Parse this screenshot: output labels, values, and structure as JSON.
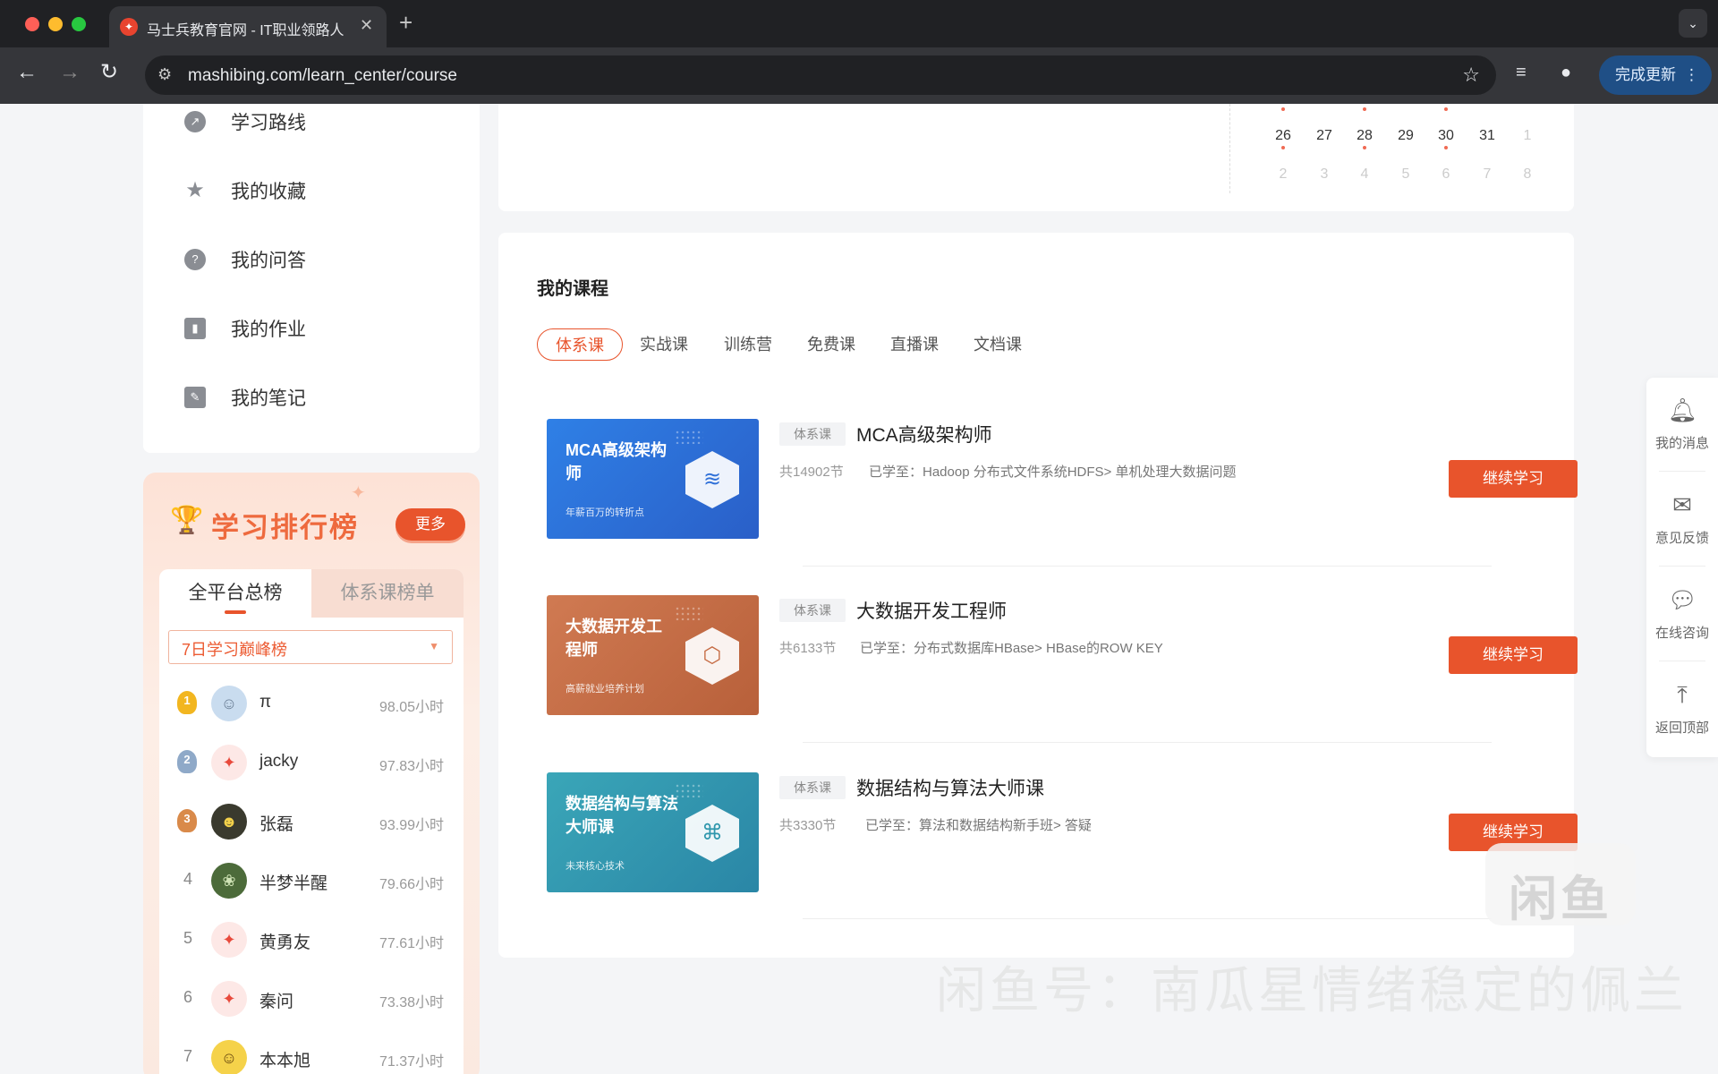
{
  "browser": {
    "tab_title": "马士兵教育官网 - IT职业领路人",
    "url": "mashibing.com/learn_center/course",
    "update_label": "完成更新",
    "colors": {
      "close": "#ff5f57",
      "minimize": "#febc2e",
      "maximize": "#28c840"
    }
  },
  "sidebar": {
    "menu": [
      {
        "label": "学习路线",
        "icon": "trend-icon"
      },
      {
        "label": "我的收藏",
        "icon": "star-icon"
      },
      {
        "label": "我的问答",
        "icon": "question-icon"
      },
      {
        "label": "我的作业",
        "icon": "book-icon"
      },
      {
        "label": "我的笔记",
        "icon": "note-icon"
      }
    ]
  },
  "ranking": {
    "title": "学习排行榜",
    "more_label": "更多",
    "tabs": [
      "全平台总榜",
      "体系课榜单"
    ],
    "select_value": "7日学习巅峰榜",
    "rows": [
      {
        "rank": "1",
        "name": "π",
        "hours": "98.05小时"
      },
      {
        "rank": "2",
        "name": "jacky",
        "hours": "97.83小时"
      },
      {
        "rank": "3",
        "name": "张磊",
        "hours": "93.99小时"
      },
      {
        "rank": "4",
        "name": "半梦半醒",
        "hours": "79.66小时"
      },
      {
        "rank": "5",
        "name": "黄勇友",
        "hours": "77.61小时"
      },
      {
        "rank": "6",
        "name": "秦问",
        "hours": "73.38小时"
      },
      {
        "rank": "7",
        "name": "本本旭",
        "hours": "71.37小时"
      }
    ]
  },
  "calendar": {
    "week1": [
      "26",
      "27",
      "28",
      "29",
      "30",
      "31",
      "1"
    ],
    "week2": [
      "2",
      "3",
      "4",
      "5",
      "6",
      "7",
      "8"
    ],
    "accent": "#f06a53"
  },
  "courses": {
    "title": "我的课程",
    "tabs": [
      "体系课",
      "实战课",
      "训练营",
      "免费课",
      "直播课",
      "文档课"
    ],
    "items": [
      {
        "thumb_title": "MCA高级架构师",
        "thumb_sub": "年薪百万的转折点",
        "tag": "体系课",
        "name": "MCA高级架构师",
        "count": "共14902节",
        "progress": "已学至：Hadoop 分布式文件系统HDFS> 单机处理大数据问题",
        "button": "继续学习",
        "color": "#2e6fd8"
      },
      {
        "thumb_title": "大数据开发工程师",
        "thumb_sub": "高薪就业培养计划",
        "tag": "体系课",
        "name": "大数据开发工程师",
        "count": "共6133节",
        "progress": "已学至：分布式数据库HBase> HBase的ROW KEY",
        "button": "继续学习",
        "color": "#c56a42"
      },
      {
        "thumb_title": "数据结构与算法大师课",
        "thumb_sub": "未来核心技术",
        "tag": "体系课",
        "name": "数据结构与算法大师课",
        "count": "共3330节",
        "progress": "已学至：算法和数据结构新手班> 答疑",
        "button": "继续学习",
        "color": "#2f97ad"
      }
    ]
  },
  "floatbar": [
    {
      "label": "我的消息",
      "icon": "bell-icon"
    },
    {
      "label": "意见反馈",
      "icon": "feedback-icon"
    },
    {
      "label": "在线咨询",
      "icon": "chat-icon"
    },
    {
      "label": "返回顶部",
      "icon": "back-to-top-icon"
    }
  ],
  "watermark": {
    "logo": "闲鱼",
    "text": "闲鱼号：南瓜星情绪稳定的佩兰"
  },
  "accent_color": "#e8542c"
}
